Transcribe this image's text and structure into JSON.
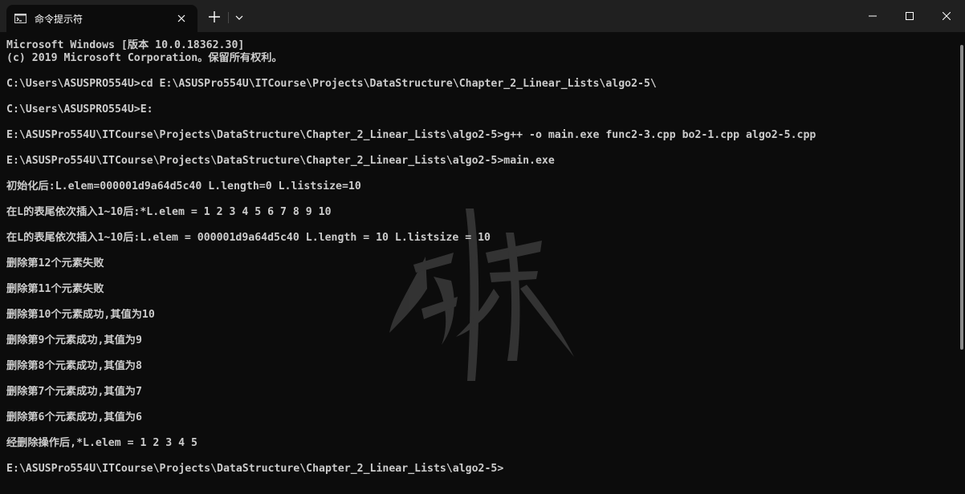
{
  "titlebar": {
    "tab_title": "命令提示符",
    "tab_icon": "cmd-icon",
    "close_tab_icon": "close-icon",
    "new_tab_icon": "plus-icon",
    "dropdown_icon": "chevron-down-icon",
    "window_controls": [
      "minimize-icon",
      "maximize-icon",
      "close-icon"
    ]
  },
  "colors": {
    "titlebar_bg": "#202020",
    "terminal_bg": "#0c0c0c",
    "text": "#cccccc"
  },
  "terminal": {
    "lines": [
      "Microsoft Windows [版本 10.0.18362.30]",
      "(c) 2019 Microsoft Corporation。保留所有权利。",
      "",
      "C:\\Users\\ASUSPRO554U>cd E:\\ASUSPro554U\\ITCourse\\Projects\\DataStructure\\Chapter_2_Linear_Lists\\algo2-5\\",
      "",
      "C:\\Users\\ASUSPRO554U>E:",
      "",
      "E:\\ASUSPro554U\\ITCourse\\Projects\\DataStructure\\Chapter_2_Linear_Lists\\algo2-5>g++ -o main.exe func2-3.cpp bo2-1.cpp algo2-5.cpp",
      "",
      "E:\\ASUSPro554U\\ITCourse\\Projects\\DataStructure\\Chapter_2_Linear_Lists\\algo2-5>main.exe",
      "",
      "初始化后:L.elem=000001d9a64d5c40 L.length=0 L.listsize=10",
      "",
      "在L的表尾依次插入1~10后:*L.elem = 1 2 3 4 5 6 7 8 9 10",
      "",
      "在L的表尾依次插入1~10后:L.elem = 000001d9a64d5c40 L.length = 10 L.listsize = 10",
      "",
      "删除第12个元素失败",
      "",
      "删除第11个元素失败",
      "",
      "删除第10个元素成功,其值为10",
      "",
      "删除第9个元素成功,其值为9",
      "",
      "删除第8个元素成功,其值为8",
      "",
      "删除第7个元素成功,其值为7",
      "",
      "删除第6个元素成功,其值为6",
      "",
      "经删除操作后,*L.elem = 1 2 3 4 5",
      "",
      "E:\\ASUSPro554U\\ITCourse\\Projects\\DataStructure\\Chapter_2_Linear_Lists\\algo2-5>"
    ]
  }
}
